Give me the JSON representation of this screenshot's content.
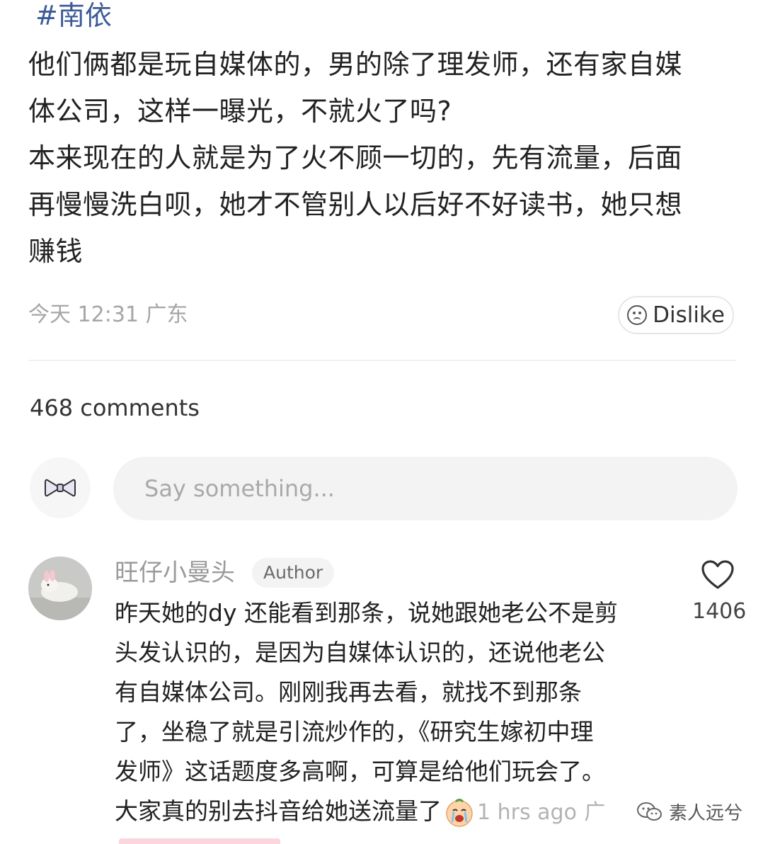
{
  "post": {
    "topic": "#南依",
    "lines": [
      "他们俩都是玩自媒体的，男的除了理发师，还有家自媒",
      "体公司，这样一曝光，不就火了吗?",
      "本来现在的人就是为了火不顾一切的，先有流量，后面",
      "再慢慢洗白呗，她才不管别人以后好不好读书，她只想",
      "赚钱"
    ],
    "time": "今天 12:31",
    "location": "广东",
    "dislike_label": "Dislike"
  },
  "comments_count": "468 comments",
  "input": {
    "placeholder": "Say something..."
  },
  "comment": {
    "username": "旺仔小曼头",
    "author_badge": "Author",
    "lines": [
      "昨天她的dy 还能看到那条，说她跟她老公不是剪",
      "头发认识的，是因为自媒体认识的，还说他老公",
      "有自媒体公司。刚刚我再去看，就找不到那条",
      "了，坐稳了就是引流炒作的，《研究生嫁初中理",
      "发师》这话题度多高啊，可算是给他们玩会了。",
      "大家真的别去抖音给她送流量了"
    ],
    "time": "1 hrs ago",
    "location_partial": "广",
    "likes": "1406"
  },
  "watermark": {
    "text": "素人远兮",
    "icon": "wechat-icon"
  },
  "icons": {
    "dislike": "sad-face-icon",
    "like": "heart-icon",
    "my_avatar": "bow-icon",
    "emoji": "crying-face-emoji"
  },
  "colors": {
    "topic": "#3c5a98",
    "muted": "#a6a6a6"
  }
}
